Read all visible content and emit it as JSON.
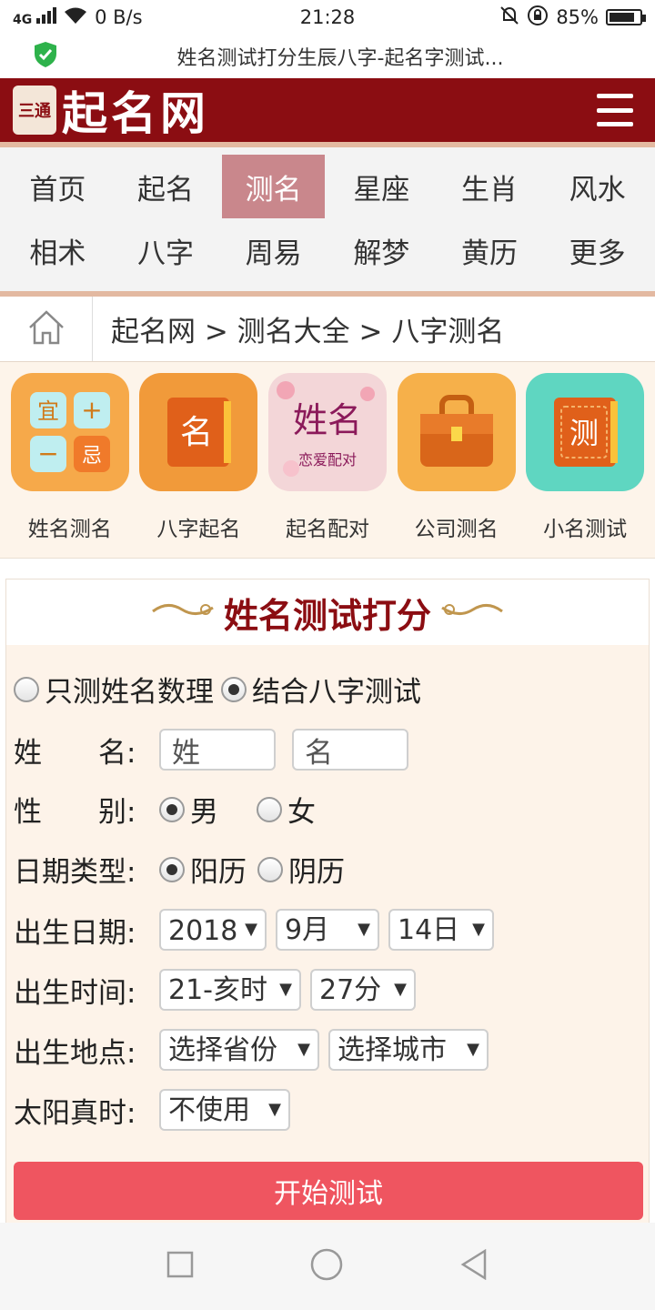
{
  "status_bar": {
    "network": "4G",
    "speed": "0 B/s",
    "time": "21:28",
    "battery": "85%",
    "battery_level": 0.85
  },
  "browser": {
    "page_title": "姓名测试打分生辰八字-起名字测试..."
  },
  "header": {
    "logo_mark": "三通",
    "logo_text": "起名网"
  },
  "nav": {
    "items": [
      "首页",
      "起名",
      "测名",
      "星座",
      "生肖",
      "风水",
      "相术",
      "八字",
      "周易",
      "解梦",
      "黄历",
      "更多"
    ],
    "active_index": 2
  },
  "breadcrumb": {
    "text": "起名网 > 测名大全 > 八字测名"
  },
  "apps": [
    {
      "label": "姓名测名",
      "icon": "calendar-grid-icon",
      "color": "#f6a94a"
    },
    {
      "label": "八字起名",
      "icon": "name-book-icon",
      "color": "#f19a3a"
    },
    {
      "label": "起名配对",
      "icon": "love-match-icon",
      "color": "#f3d6d8"
    },
    {
      "label": "公司测名",
      "icon": "briefcase-icon",
      "color": "#f6b04a"
    },
    {
      "label": "小名测试",
      "icon": "test-book-icon",
      "color": "#5fd6c1"
    }
  ],
  "form": {
    "title": "姓名测试打分",
    "mode_options": [
      "只测姓名数理",
      "结合八字测试"
    ],
    "mode_selected": 1,
    "name_label": "姓　　名:",
    "surname_placeholder": "姓",
    "given_placeholder": "名",
    "gender_label": "性　　别:",
    "gender_options": [
      "男",
      "女"
    ],
    "gender_selected": 0,
    "date_type_label": "日期类型:",
    "date_type_options": [
      "阳历",
      "阴历"
    ],
    "date_type_selected": 0,
    "birth_date_label": "出生日期:",
    "year": "2018",
    "month": "9月",
    "day": "14日",
    "birth_time_label": "出生时间:",
    "hour": "21-亥时",
    "minute": "27分",
    "birth_place_label": "出生地点:",
    "province": "选择省份",
    "city": "选择城市",
    "solar_time_label": "太阳真时:",
    "solar_time": "不使用",
    "submit_label": "开始测试"
  },
  "colors": {
    "brand": "#8b0d12",
    "accent": "#ef5560",
    "nav_active": "#c9878c"
  }
}
